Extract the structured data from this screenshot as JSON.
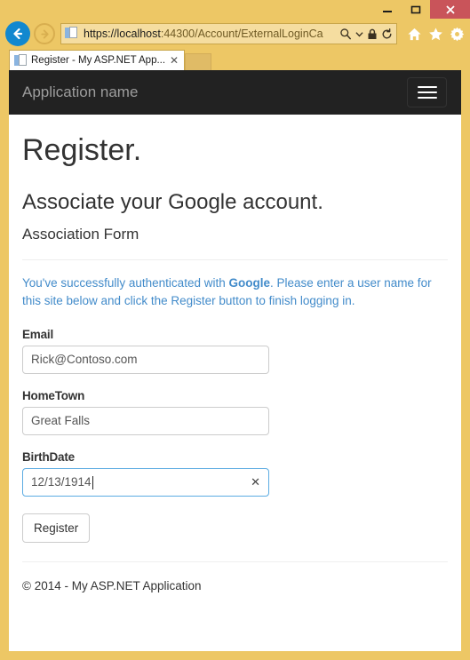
{
  "browser": {
    "window_controls": {
      "minimize": "minimize-label",
      "maximize": "maximize-label",
      "close": "✕"
    },
    "back_label": "Back",
    "forward_label": "Forward",
    "address": {
      "url_full": "https://localhost:44300/Account/ExternalLoginCa",
      "url_scheme_host": "https://localhost",
      "url_rest": ":44300/Account/ExternalLoginCa",
      "search_icon": "🔍",
      "dropdown_icon": "▾",
      "lock_icon": "🔒",
      "refresh_icon": "⟳"
    },
    "toolbar_icons": {
      "home": "home-icon",
      "favorites": "star-icon",
      "settings": "gear-icon"
    },
    "tab": {
      "title": "Register - My ASP.NET App...",
      "close": "✕"
    },
    "new_tab_label": ""
  },
  "page": {
    "navbar": {
      "brand": "Application name",
      "toggle_label": "Toggle navigation"
    },
    "title": "Register.",
    "subtitle": "Associate your Google account.",
    "form_title": "Association Form",
    "info": {
      "before": "You've successfully authenticated with ",
      "provider": "Google",
      "after": ". Please enter a user name for this site below and click the Register button to finish logging in."
    },
    "fields": [
      {
        "label": "Email",
        "value": "Rick@Contoso.com",
        "focused": false
      },
      {
        "label": "HomeTown",
        "value": "Great Falls",
        "focused": false
      },
      {
        "label": "BirthDate",
        "value": "12/13/1914",
        "focused": true,
        "clear_icon": "✕"
      }
    ],
    "submit_label": "Register",
    "footer": "© 2014 - My ASP.NET Application"
  },
  "colors": {
    "frame": "#edc765",
    "navbar_bg": "#222222",
    "brand_text": "#9d9d9d",
    "info_text": "#428bca",
    "focus_border": "#5babe2",
    "close_button": "#c9545a",
    "back_button": "#1288cf"
  }
}
